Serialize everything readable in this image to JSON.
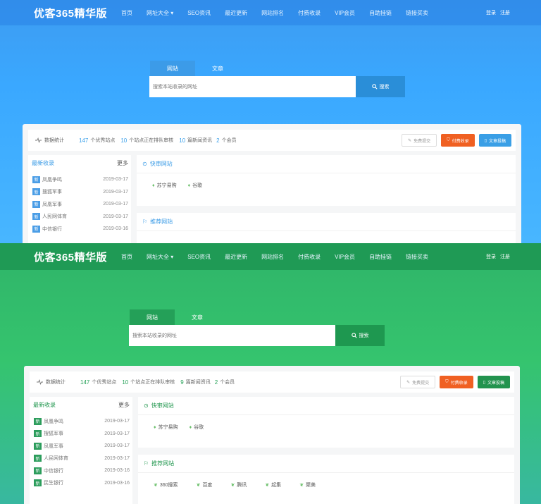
{
  "site": {
    "logo": "优客365精华版",
    "nav": [
      "首页",
      "网址大全 ▾",
      "SEO资讯",
      "最近更新",
      "网站排名",
      "付费收录",
      "VIP会员",
      "自助挂链",
      "链接买卖"
    ],
    "login": "登录",
    "register": "注册"
  },
  "search": {
    "tabs": [
      "网站",
      "文章"
    ],
    "placeholder": "搜索本站收录的网址",
    "button": "搜索"
  },
  "stats": {
    "label": "数据统计",
    "sites_count": "147",
    "sites_text": "个优秀站点",
    "queue_count": "10",
    "queue_text": "个站点正在排队审核",
    "news_blue_count": "10",
    "news_green_count": "9",
    "news_text": "篇新闻资讯",
    "members_count": "2",
    "members_text": "个会员"
  },
  "actions": {
    "submit": "免费提交",
    "paid": "付费收录",
    "article": "文章投稿"
  },
  "recent": {
    "title": "最新收录",
    "more": "更多",
    "badge": "新",
    "items_blue": [
      {
        "name": "凤凰争鸣",
        "date": "2019-03-17"
      },
      {
        "name": "搜狐军事",
        "date": "2019-03-17"
      },
      {
        "name": "凤凰军事",
        "date": "2019-03-17"
      },
      {
        "name": "人民网体育",
        "date": "2019-03-17"
      },
      {
        "name": "中信银行",
        "date": "2019-03-16"
      }
    ],
    "items_green": [
      {
        "name": "凤凰争鸣",
        "date": "2019-03-17"
      },
      {
        "name": "搜狐军事",
        "date": "2019-03-17"
      },
      {
        "name": "凤凰军事",
        "date": "2019-03-17"
      },
      {
        "name": "人民网体育",
        "date": "2019-03-17"
      },
      {
        "name": "中信银行",
        "date": "2019-03-16"
      },
      {
        "name": "民生银行",
        "date": "2019-03-16"
      }
    ]
  },
  "sections": {
    "fast_review": "快审网站",
    "fast_sites": [
      "苏宁易购",
      "谷歌"
    ],
    "recommended": "推荐网站",
    "recommended_sites": [
      "360搜索",
      "百度",
      "腾讯",
      "起集",
      "聚美"
    ]
  },
  "colors": {
    "blue_theme": "#3aa8ff",
    "green_theme": "#35c46e",
    "paid_orange": "#f06022"
  }
}
